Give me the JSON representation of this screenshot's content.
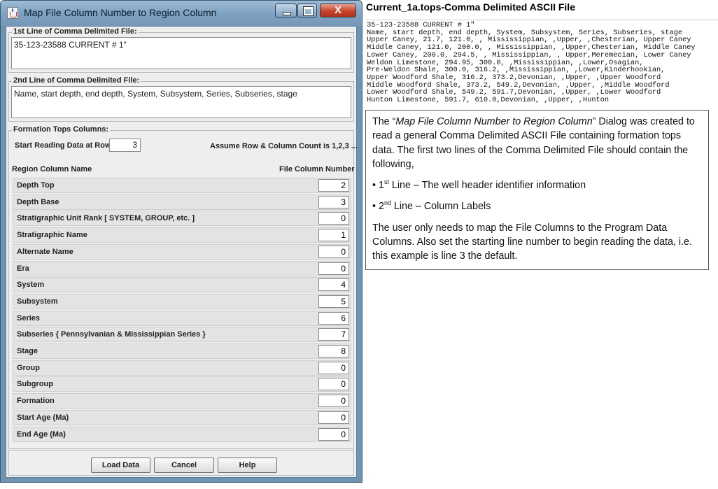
{
  "dialog": {
    "title": "Map File Column Number to Region Column",
    "close_glyph": "X",
    "first_line": {
      "legend": "1st Line of Comma Delimited File:",
      "value": "35-123-23588 CURRENT # 1\""
    },
    "second_line": {
      "legend": "2nd Line of Comma Delimited File:",
      "value": "Name, start depth, end depth, System, Subsystem, Series, Subseries, stage"
    },
    "formation": {
      "legend": "Formation Tops Columns:",
      "start_label": "Start Reading Data at Row",
      "start_value": "3",
      "assume_note": "Assume Row & Column Count is 1,2,3 ...",
      "header_region": "Region Column Name",
      "header_file": "File Column Number",
      "rows": [
        {
          "name": "Depth Top",
          "value": "2"
        },
        {
          "name": "Depth Base",
          "value": "3"
        },
        {
          "name": "Stratigraphic Unit Rank [ SYSTEM, GROUP, etc. ]",
          "value": "0"
        },
        {
          "name": "Stratigraphic Name",
          "value": "1"
        },
        {
          "name": "Alternate Name",
          "value": "0"
        },
        {
          "name": "Era",
          "value": "0"
        },
        {
          "name": "System",
          "value": "4"
        },
        {
          "name": "Subsystem",
          "value": "5"
        },
        {
          "name": "Series",
          "value": "6"
        },
        {
          "name": "Subseries { Pennsylvanian & Mississippian Series }",
          "value": "7"
        },
        {
          "name": "Stage",
          "value": "8"
        },
        {
          "name": "Group",
          "value": "0"
        },
        {
          "name": "Subgroup",
          "value": "0"
        },
        {
          "name": "Formation",
          "value": "0"
        },
        {
          "name": "Start Age (Ma)",
          "value": "0"
        },
        {
          "name": "End Age (Ma)",
          "value": "0"
        }
      ]
    },
    "buttons": {
      "load": "Load Data",
      "cancel": "Cancel",
      "help": "Help"
    }
  },
  "file_view": {
    "title": "Current_1a.tops-Comma Delimited ASCII File",
    "lines": [
      "35-123-23588 CURRENT # 1\"",
      "Name, start depth, end depth, System, Subsystem, Series, Subseries, stage",
      "Upper Caney, 21.7, 121.0, , Mississippian, ,Upper, ,Chesterian, Upper Caney",
      "Middle Caney, 121.0, 200.0, , Mississippian, ,Upper,Chesterian, Middle Caney",
      "Lower Caney, 200.0, 294.5, , Mississippian, , Upper,Meremecian, Lower Caney",
      "Weldon Limestone, 294.95, 300.0, ,Mississippian, ,Lower,Osagian,",
      "Pre-Weldon Shale, 300.0, 316.2, ,Mississippian, ,Lower,Kinderhookian,",
      "Upper Woodford Shale, 316.2, 373.2,Devonian, ,Upper, ,Upper Woodford",
      "Middle Woodford Shale, 373.2, 549.2,Devonian, ,Upper, ,Middle Woodford",
      "Lower Woodford Shale, 549.2, 591.7,Devonian, ,Upper, ,Lower Woodford",
      "Hunton Limestone, 591.7, 610.0,Devonian, ,Upper, ,Hunton"
    ]
  },
  "description": {
    "p1_pre": "The “",
    "p1_em": "Map File Column Number to Region Column",
    "p1_post": "” Dialog was created to read a general Comma Delimited ASCII File containing formation tops data. The first two lines of the Comma Delimited File should contain the following,",
    "bullet1_num": "1",
    "bullet1_sup": "st",
    "bullet1_text": " Line – The well header identifier information",
    "bullet2_num": "2",
    "bullet2_sup": "nd",
    "bullet2_text": " Line – Column Labels",
    "p2": "The user only needs to map the File Columns to the Program Data Columns.  Also set the starting line number to begin reading the data, i.e. this example is line 3 the default."
  }
}
